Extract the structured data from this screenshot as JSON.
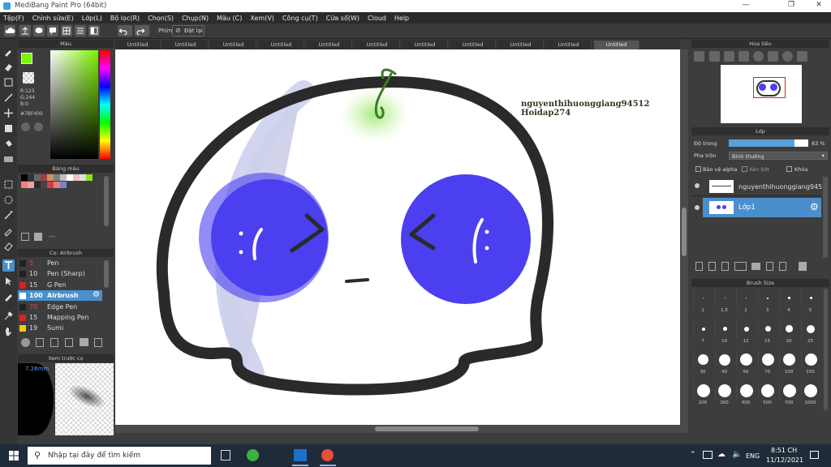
{
  "window": {
    "title": "MediBang Paint Pro (64bit)"
  },
  "menu": [
    "Tệp(F)",
    "Chỉnh sửa(E)",
    "Lớp(L)",
    "Bộ lọc(R)",
    "Chọn(S)",
    "Chụp(N)",
    "Màu (C)",
    "Xem(V)",
    "Công cụ(T)",
    "Cửa sổ(W)",
    "Cloud",
    "Help"
  ],
  "toolbar": {
    "key_label": "Phím",
    "reset_label": "Đặt lại"
  },
  "color_panel": {
    "title": "Màu",
    "primary_color": "#7BF400",
    "r": "R:123",
    "g": "G:244",
    "b": "B:0",
    "hex": "#7BF400"
  },
  "palette_panel": {
    "title": "Bảng màu",
    "status": "---"
  },
  "brush_panel": {
    "title": "Cọ: Airbrush",
    "brushes": [
      {
        "size": "5",
        "name": "Pen",
        "color": "#222222"
      },
      {
        "size": "10",
        "name": "Pen (Sharp)",
        "color": "#222222"
      },
      {
        "size": "15",
        "name": "G Pen",
        "color": "#e02020"
      },
      {
        "size": "100",
        "name": "Airbrush",
        "color": "#ffffff",
        "selected": true
      },
      {
        "size": "70",
        "name": "Edge Pen",
        "color": "#222222"
      },
      {
        "size": "15",
        "name": "Mapping Pen",
        "color": "#e02020"
      },
      {
        "size": "19",
        "name": "Sumi",
        "color": "#f0d000"
      }
    ]
  },
  "preview_panel": {
    "title": "Xem trước cọ",
    "size_readout": "7.26mm"
  },
  "tabs": [
    "Untitled",
    "Untitled",
    "Untitled",
    "Untitled",
    "Untitled",
    "Untitled",
    "Untitled",
    "Untitled",
    "Untitled",
    "Untitled",
    "Untitled"
  ],
  "canvas": {
    "text_line1": "nguyenthihuonggiang94512",
    "text_line2": "Hoidap274"
  },
  "navigator_panel": {
    "title": "Hoa tiêu"
  },
  "layer_panel": {
    "title": "Lớp",
    "opacity_label": "Độ trong",
    "opacity_value": "83 %",
    "opacity": 0.83,
    "blend_label": "Pha trộn",
    "blend_value": "Bình thường",
    "protect_alpha": "Bảo vệ alpha",
    "clipping": "Xén bớt",
    "lock": "Khóa",
    "layers": [
      {
        "name": "nguyenthihuonggiang9451",
        "selected": false
      },
      {
        "name": "Lớp1",
        "selected": true
      }
    ]
  },
  "brush_size_panel": {
    "title": "Brush Size",
    "sizes": [
      "1",
      "1.5",
      "2",
      "3",
      "4",
      "5",
      "7",
      "10",
      "12",
      "15",
      "20",
      "25",
      "30",
      "40",
      "50",
      "70",
      "100",
      "150",
      "200",
      "300",
      "400",
      "500",
      "700",
      "1000"
    ]
  },
  "taskbar": {
    "search_placeholder": "Nhập tại đây để tìm kiếm",
    "lang": "ENG",
    "time": "8:51 CH",
    "date": "11/12/2021"
  }
}
